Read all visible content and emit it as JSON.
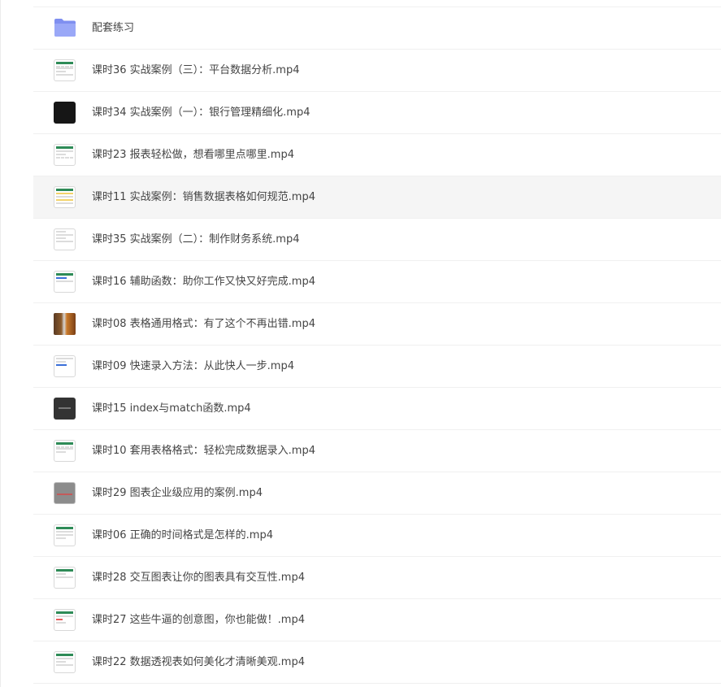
{
  "files": [
    {
      "name": "配套练习",
      "icon": "folder-icon"
    },
    {
      "name": "课时36 实战案例（三）：平台数据分析.mp4",
      "icon": "spreadsheet-thumbnail-icon"
    },
    {
      "name": "课时34 实战案例（一）：银行管理精细化.mp4",
      "icon": "dark-video-thumbnail-icon"
    },
    {
      "name": "课时23 报表轻松做，想看哪里点哪里.mp4",
      "icon": "spreadsheet-thumbnail-icon"
    },
    {
      "name": "课时11 实战案例：销售数据表格如何规范.mp4",
      "icon": "spreadsheet-thumbnail-icon"
    },
    {
      "name": "课时35 实战案例（二）：制作财务系统.mp4",
      "icon": "spreadsheet-thumbnail-icon"
    },
    {
      "name": "课时16 辅助函数：助你工作又快又好完成.mp4",
      "icon": "spreadsheet-thumbnail-icon"
    },
    {
      "name": "课时08 表格通用格式：有了这个不再出错.mp4",
      "icon": "photo-thumbnail-icon"
    },
    {
      "name": "课时09 快速录入方法：从此快人一步.mp4",
      "icon": "spreadsheet-thumbnail-icon"
    },
    {
      "name": "课时15 index与match函数.mp4",
      "icon": "dark-video-thumbnail-icon"
    },
    {
      "name": "课时10 套用表格格式：轻松完成数据录入.mp4",
      "icon": "spreadsheet-thumbnail-icon"
    },
    {
      "name": "课时29 图表企业级应用的案例.mp4",
      "icon": "chart-thumbnail-icon"
    },
    {
      "name": "课时06 正确的时间格式是怎样的.mp4",
      "icon": "spreadsheet-thumbnail-icon"
    },
    {
      "name": "课时28 交互图表让你的图表具有交互性.mp4",
      "icon": "spreadsheet-thumbnail-icon"
    },
    {
      "name": "课时27 这些牛逼的创意图，你也能做！.mp4",
      "icon": "spreadsheet-thumbnail-icon"
    },
    {
      "name": "课时22 数据透视表如何美化才清晰美观.mp4",
      "icon": "spreadsheet-thumbnail-icon"
    }
  ],
  "colors": {
    "folder": "#8f9ef5",
    "row_hover": "#f5f5f5",
    "sheet_header": "#2e8b57"
  }
}
